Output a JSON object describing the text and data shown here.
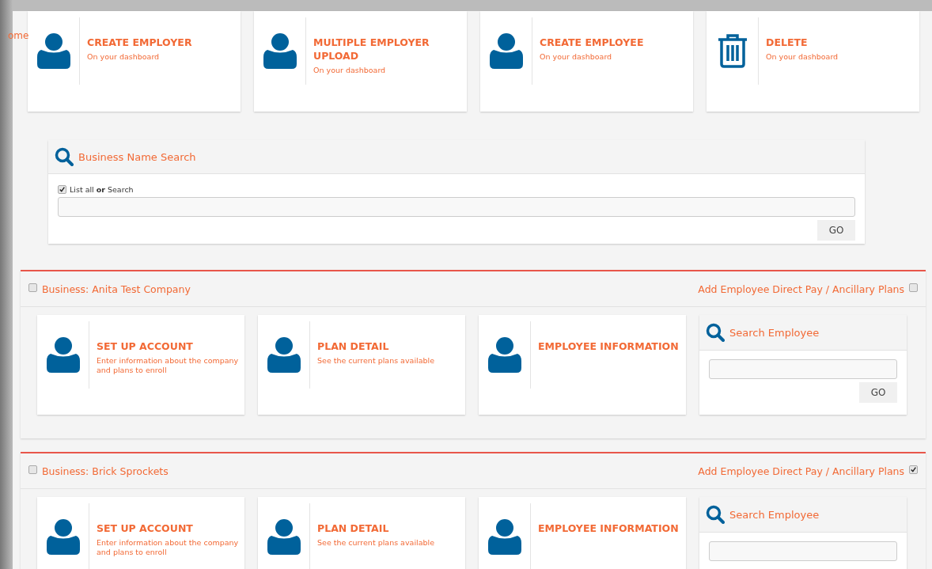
{
  "home_link": "ome",
  "top_actions": [
    {
      "kind": "person",
      "title": "CREATE EMPLOYER",
      "subtitle": "On your dashboard"
    },
    {
      "kind": "person",
      "title": "MULTIPLE EMPLOYER UPLOAD",
      "subtitle": "On your dashboard"
    },
    {
      "kind": "person",
      "title": "CREATE EMPLOYEE",
      "subtitle": "On your dashboard"
    },
    {
      "kind": "trash",
      "title": "DELETE",
      "subtitle": "On your dashboard"
    }
  ],
  "business_search": {
    "title": "Business Name Search",
    "list_all": {
      "label": "List all **or** Search",
      "checked": true
    },
    "button": "GO"
  },
  "businesses": [
    {
      "name": "Business: Anita Test Company",
      "checked": false,
      "ancillary": {
        "label": "Add Employee Direct Pay / Ancillary Plans",
        "checked": false
      },
      "tiles": [
        {
          "title": "SET UP ACCOUNT",
          "subtitle": "Enter information about the company and plans to enroll"
        },
        {
          "title": "PLAN DETAIL",
          "subtitle": "See the current plans available"
        },
        {
          "title": "EMPLOYEE INFORMATION"
        }
      ],
      "search": {
        "title": "Search Employee",
        "button": "GO"
      }
    },
    {
      "name": "Business: Brick Sprockets",
      "checked": false,
      "ancillary": {
        "label": "Add Employee Direct Pay / Ancillary Plans",
        "checked": true
      },
      "tiles": [
        {
          "title": "SET UP ACCOUNT",
          "subtitle": "Enter information about the company and plans to enroll"
        },
        {
          "title": "PLAN DETAIL",
          "subtitle": "See the current plans available"
        },
        {
          "title": "EMPLOYEE INFORMATION"
        }
      ],
      "search": {
        "title": "Search Employee"
      }
    }
  ]
}
